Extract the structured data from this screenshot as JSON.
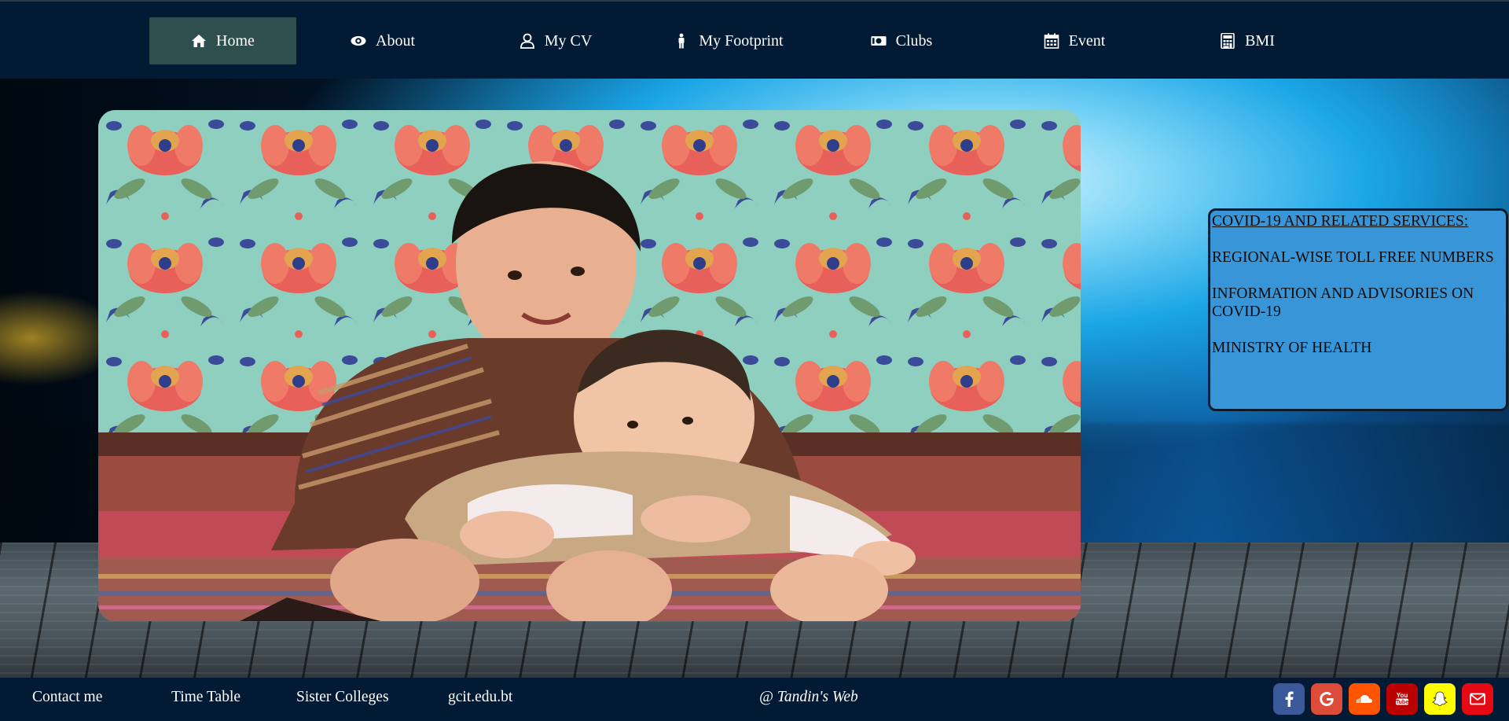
{
  "nav": {
    "items": [
      {
        "label": "Home",
        "icon": "home-icon",
        "active": true
      },
      {
        "label": "About",
        "icon": "eye-icon",
        "active": false
      },
      {
        "label": "My CV",
        "icon": "user-icon",
        "active": false
      },
      {
        "label": "My Footprint",
        "icon": "person-icon",
        "active": false
      },
      {
        "label": "Clubs",
        "icon": "money-icon",
        "active": false
      },
      {
        "label": "Event",
        "icon": "calendar-icon",
        "active": false
      },
      {
        "label": "BMI",
        "icon": "calculator-icon",
        "active": false
      }
    ],
    "colors": {
      "bar": "#021a33",
      "active": "#2f4f4f",
      "text": "#ffffff"
    }
  },
  "hero": {
    "image": "photo of two children in traditional Bhutanese dress against a floral wall"
  },
  "covid": {
    "heading": "COVID-19 AND RELATED SERVICES:",
    "links": [
      "REGIONAL-WISE TOLL FREE NUMBERS",
      "INFORMATION AND ADVISORIES ON COVID-19",
      "MINISTRY OF HEALTH"
    ],
    "background": "#3896d8"
  },
  "footer": {
    "links": [
      "Contact me",
      "Time Table",
      "Sister Colleges",
      "gcit.edu.bt"
    ],
    "credit": "@ Tandin's Web",
    "social": [
      {
        "name": "facebook-icon",
        "color": "#3b5998"
      },
      {
        "name": "google-icon",
        "color": "#dd4b39"
      },
      {
        "name": "soundcloud-icon",
        "color": "#ff5500"
      },
      {
        "name": "youtube-icon",
        "color": "#bb0000"
      },
      {
        "name": "snapchat-icon",
        "color": "#fffc00"
      },
      {
        "name": "mail-icon",
        "color": "#e50914"
      }
    ]
  }
}
